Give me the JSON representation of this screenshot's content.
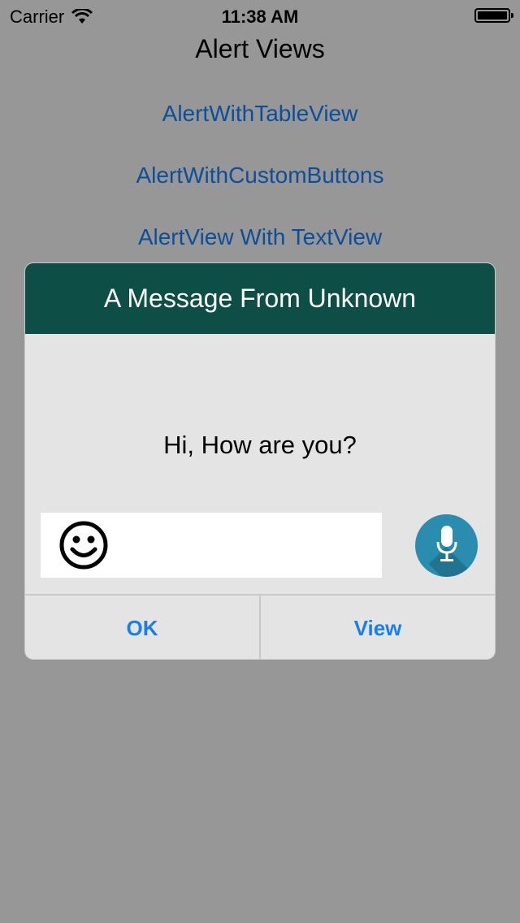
{
  "status_bar": {
    "carrier": "Carrier",
    "time": "11:38 AM"
  },
  "page": {
    "title": "Alert Views",
    "links": [
      "AlertWithTableView",
      "AlertWithCustomButtons",
      "AlertView With TextView"
    ]
  },
  "alert": {
    "title": "A Message From Unknown",
    "message": "Hi, How are you?",
    "input_value": "",
    "buttons": {
      "ok": "OK",
      "view": "View"
    }
  },
  "colors": {
    "background": "#979797",
    "alert_header": "#0d4f47",
    "link": "#0b4f9a",
    "button_text": "#1a7fe6",
    "mic_button": "#2a8db0"
  },
  "icons": [
    "wifi-icon",
    "battery-icon",
    "smiley-icon",
    "microphone-icon"
  ]
}
